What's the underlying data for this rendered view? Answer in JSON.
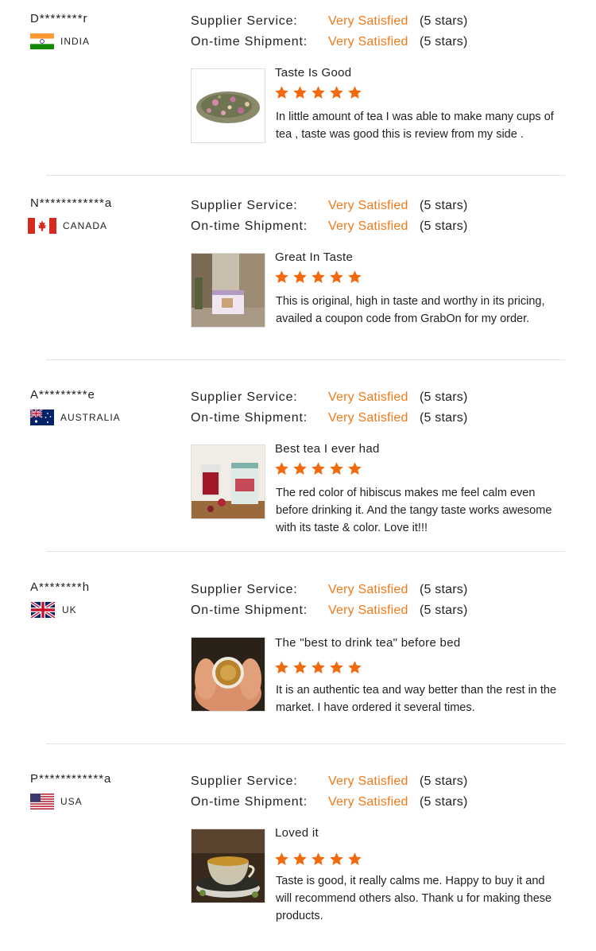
{
  "labels": {
    "supplier_service": "Supplier Service:",
    "on_time_shipment": "On-time Shipment:"
  },
  "colors": {
    "accent": "#f07a1a",
    "star": "#f26a10",
    "divider": "#dde6ea"
  },
  "reviews": [
    {
      "reviewer": "D********r",
      "country": "INDIA",
      "flag_icon": "india-flag-icon",
      "supplier_rating": "Very Satisfied",
      "supplier_stars": "(5 stars)",
      "shipment_rating": "Very Satisfied",
      "shipment_stars": "(5 stars)",
      "title": "Taste Is Good",
      "rating": 5,
      "text": "In little amount of tea I was able to make many cups of tea , taste was good this is review from my side .",
      "image_icon": "loose-leaf-tea-image"
    },
    {
      "reviewer": "N************a",
      "country": "CANADA",
      "flag_icon": "canada-flag-icon",
      "supplier_rating": "Very Satisfied",
      "supplier_stars": "(5 stars)",
      "shipment_rating": "Very Satisfied",
      "shipment_stars": "(5 stars)",
      "title": "Great In Taste",
      "rating": 5,
      "text": "This is original, high in taste and worthy in its pricing, availed a coupon code from GrabOn for my order.",
      "image_icon": "tea-tin-image"
    },
    {
      "reviewer": "A*********e",
      "country": "AUSTRALIA",
      "flag_icon": "australia-flag-icon",
      "supplier_rating": "Very Satisfied",
      "supplier_stars": "(5 stars)",
      "shipment_rating": "Very Satisfied",
      "shipment_stars": "(5 stars)",
      "title": "Best tea I ever had",
      "rating": 5,
      "text": "The red color of hibiscus makes me feel calm even before drinking it. And the tangy taste works awesome with its taste & color. Love it!!!",
      "image_icon": "hibiscus-tea-image"
    },
    {
      "reviewer": "A********h",
      "country": "UK",
      "flag_icon": "uk-flag-icon",
      "supplier_rating": "Very Satisfied",
      "supplier_stars": "(5 stars)",
      "shipment_rating": "Very Satisfied",
      "shipment_stars": "(5 stars)",
      "title": "The \"best to drink tea\" before bed",
      "rating": 5,
      "text": "It is an authentic tea and way better than the rest in the market. I have ordered it several times.",
      "image_icon": "hands-holding-tea-image"
    },
    {
      "reviewer": "P************a",
      "country": "USA",
      "flag_icon": "usa-flag-icon",
      "supplier_rating": "Very Satisfied",
      "supplier_stars": "(5 stars)",
      "shipment_rating": "Very Satisfied",
      "shipment_stars": "(5 stars)",
      "title": "Loved it",
      "rating": 5,
      "text": "Taste is good, it really calms me. Happy to buy it and will recommend others also. Thank u for making these products.",
      "image_icon": "tea-cup-image"
    }
  ]
}
